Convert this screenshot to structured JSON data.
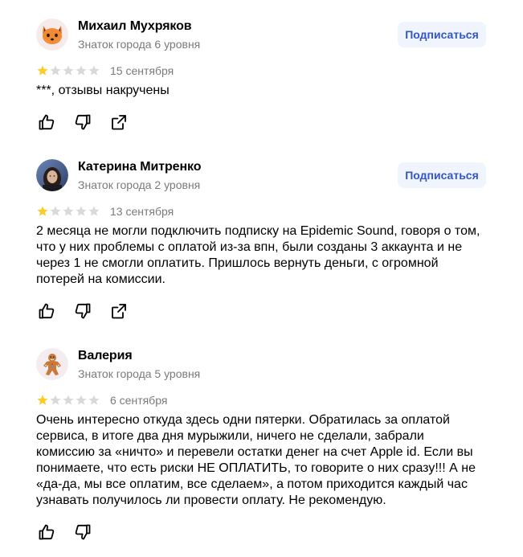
{
  "colors": {
    "star_filled": "#fccb28",
    "star_empty": "#d9d9d9",
    "subscribe_bg": "#f0f4fc",
    "subscribe_text": "#3355cc",
    "muted_text": "#7a7a7a"
  },
  "reviews": [
    {
      "author": "Михаил Мухряков",
      "level": "Знаток города 6 уровня",
      "subscribe_label": "Подписаться",
      "rating": 1,
      "max_rating": 5,
      "date": "15 сентября",
      "text": "***, отзывы накручены",
      "avatar_icon": "fox-emoji-avatar",
      "actions": [
        "like-icon",
        "dislike-icon",
        "share-icon"
      ]
    },
    {
      "author": "Катерина Митренко",
      "level": "Знаток города 2 уровня",
      "subscribe_label": "Подписаться",
      "rating": 1,
      "max_rating": 5,
      "date": "13 сентября",
      "text": "2 месяца не могли подключить подписку на Epidemic Sound, говоря о том, что у них проблемы с оплатой из-за впн, были созданы 3 аккаунта и не через 1 не смогли оплатить. Пришлось вернуть деньги, с огромной потерей на комиссии.",
      "avatar_icon": "user-photo-avatar",
      "actions": [
        "like-icon",
        "dislike-icon",
        "share-icon"
      ]
    },
    {
      "author": "Валерия",
      "level": "Знаток города 5 уровня",
      "rating": 1,
      "max_rating": 5,
      "date": "6 сентября",
      "text": "Очень интересно откуда здесь одни пятерки. Обратилась за оплатой сервиса, в итоге два дня мурыжили, ничего не сделали, забрали комиссию за «ничто» и перевели остатки денег на счет Apple id. Если вы понимаете, что есть риски НЕ ОПЛАТИТЬ, то говорите о них сразу!!! А не «да-да, мы все оплатим, все сделаем», а потом приходится каждый час узнавать получилось ли провести оплату. Не рекомендую.",
      "avatar_icon": "gingerbread-emoji-avatar",
      "actions": [
        "like-icon",
        "dislike-icon"
      ]
    }
  ]
}
